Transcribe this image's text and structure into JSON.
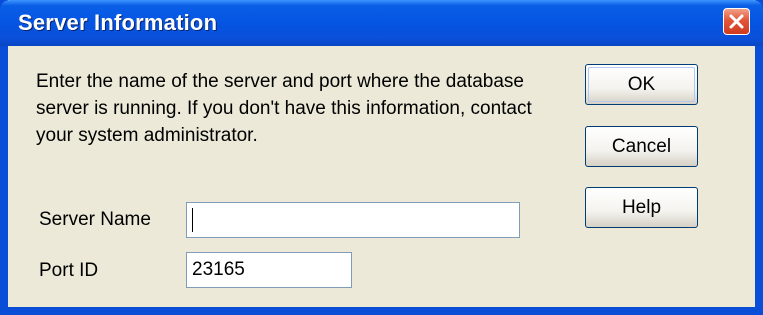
{
  "window": {
    "title": "Server Information"
  },
  "message": "Enter the name of the server and port where the database server is running. If you don't have this information, contact your system administrator.",
  "fields": {
    "server_name": {
      "label": "Server Name",
      "value": ""
    },
    "port_id": {
      "label": "Port ID",
      "value": "23165"
    }
  },
  "buttons": {
    "ok": "OK",
    "cancel": "Cancel",
    "help": "Help"
  },
  "icons": {
    "close": "close-icon"
  },
  "colors": {
    "titlebar": "#0554e3",
    "dialog_bg": "#ece9d8",
    "close_button": "#e2563a",
    "input_border": "#7f9db9",
    "button_border": "#003c74"
  }
}
